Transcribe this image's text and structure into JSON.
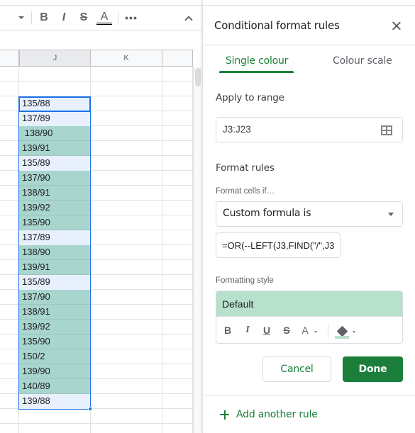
{
  "toolbar": {
    "bold_label": "B",
    "italic_label": "I",
    "strikethrough_label": "S",
    "text_color_label": "A",
    "more_label": "•••"
  },
  "columns": {
    "headers": [
      "",
      "J",
      "K",
      ""
    ]
  },
  "grid": {
    "rows": [
      {
        "value": "",
        "highlighted": false
      },
      {
        "value": "",
        "highlighted": false
      },
      {
        "value": "135/88",
        "highlighted": false
      },
      {
        "value": "137/89",
        "highlighted": false
      },
      {
        "value": " 138/90",
        "highlighted": true
      },
      {
        "value": "139/91",
        "highlighted": true
      },
      {
        "value": "135/89",
        "highlighted": false
      },
      {
        "value": "137/90",
        "highlighted": true
      },
      {
        "value": "138/91",
        "highlighted": true
      },
      {
        "value": "139/92",
        "highlighted": true
      },
      {
        "value": "135/90",
        "highlighted": true
      },
      {
        "value": "137/89",
        "highlighted": false
      },
      {
        "value": "138/90",
        "highlighted": true
      },
      {
        "value": "139/91",
        "highlighted": true
      },
      {
        "value": "135/89",
        "highlighted": false
      },
      {
        "value": "137/90",
        "highlighted": true
      },
      {
        "value": "138/91",
        "highlighted": true
      },
      {
        "value": "139/92",
        "highlighted": true
      },
      {
        "value": "135/90",
        "highlighted": true
      },
      {
        "value": "150/2",
        "highlighted": true
      },
      {
        "value": "139/90",
        "highlighted": true
      },
      {
        "value": "140/89",
        "highlighted": true
      },
      {
        "value": "139/88",
        "highlighted": false
      },
      {
        "value": "",
        "highlighted": false
      },
      {
        "value": "",
        "highlighted": false
      }
    ],
    "colors": {
      "highlight": "#a8d5ce",
      "selected": "#e8f0fe",
      "selection_border": "#1a73e8"
    }
  },
  "sidebar": {
    "title": "Conditional format rules",
    "tabs": [
      {
        "label": "Single colour",
        "active": true
      },
      {
        "label": "Colour scale",
        "active": false
      }
    ],
    "apply_to_range_label": "Apply to range",
    "range_value": "J3:J23",
    "format_rules_label": "Format rules",
    "format_cells_if_label": "Format cells if…",
    "condition_selected": "Custom formula is",
    "formula_value": "=OR(--LEFT(J3,FIND(\"/\",J3",
    "formatting_style_label": "Formatting style",
    "style_preview_label": "Default",
    "style_tools": {
      "bold": "B",
      "italic": "I",
      "underline": "U",
      "strikethrough": "S",
      "text_color": "A"
    },
    "cancel_label": "Cancel",
    "done_label": "Done",
    "add_rule_label": "Add another rule",
    "colors": {
      "accent": "#188038",
      "done_bg": "#1b7f3b",
      "style_fill": "#b7e1cd"
    }
  }
}
